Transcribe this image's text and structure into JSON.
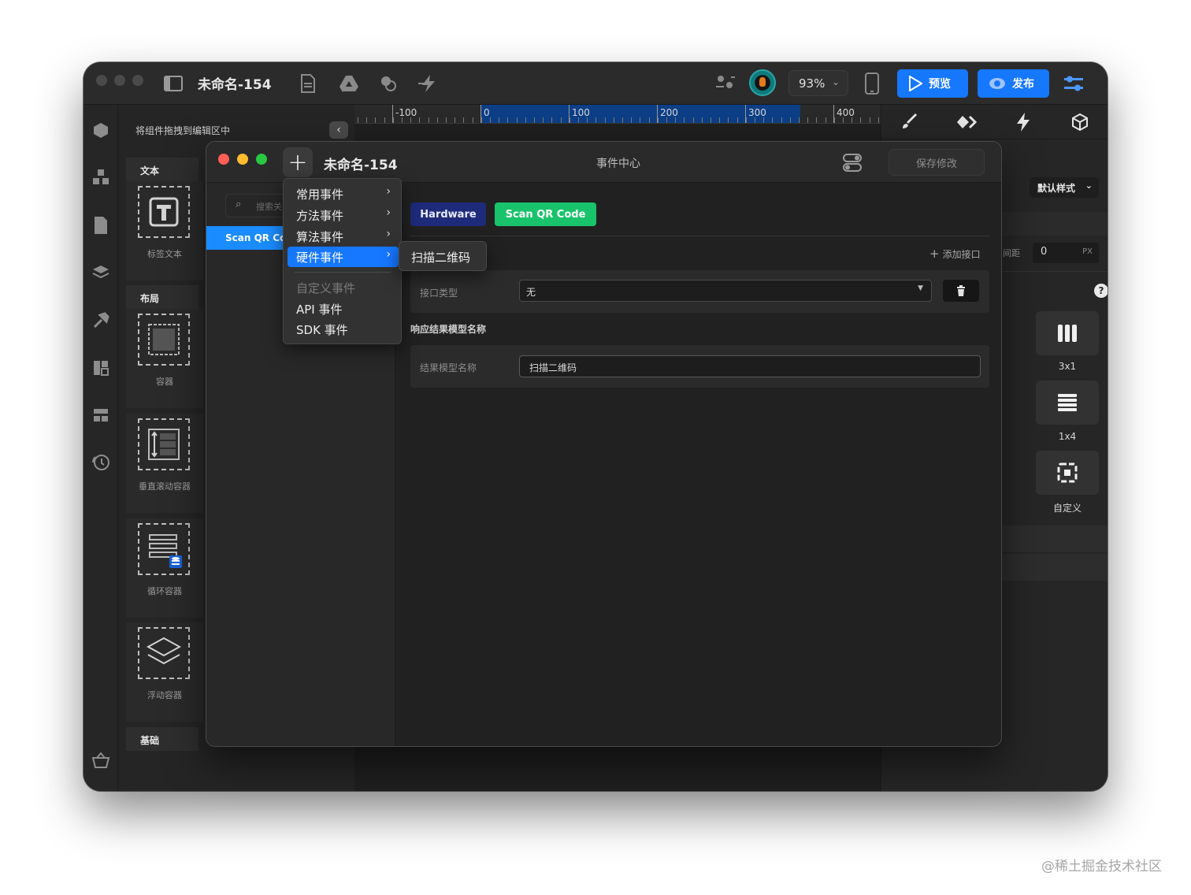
{
  "app": {
    "title": "未命名-154",
    "zoom": "93%",
    "preview_label": "预览",
    "publish_label": "发布"
  },
  "ruler": {
    "ticks": [
      "-100",
      "0",
      "100",
      "200",
      "300",
      "400"
    ]
  },
  "component_panel": {
    "header": "将组件拖拽到编辑区中",
    "sections": {
      "text": "文本",
      "layout": "布局",
      "basic": "基础"
    },
    "components": {
      "label_text": "标签文本",
      "container": "容器",
      "vertical_scroll": "垂直滚动容器",
      "loop_container": "循环容器",
      "float_container": "浮动容器"
    }
  },
  "right_panel": {
    "style_select": "默认样式",
    "spacing_label": "间距",
    "spacing_value": "0",
    "spacing_unit": "PX",
    "layouts": [
      "3x1",
      "1x4",
      "自定义"
    ]
  },
  "event_center": {
    "title": "事件中心",
    "doc_title": "未命名-154",
    "save_label": "保存修改",
    "search_placeholder": "搜索关",
    "selected_event": "Scan QR Code",
    "tags": {
      "hardware": "Hardware",
      "scan": "Scan QR Code"
    },
    "add_interface": "添加接口",
    "interface_type_label": "接口类型",
    "interface_type_value": "无",
    "response_section": "响应结果模型名称",
    "result_model_label": "结果模型名称",
    "result_model_value": "扫描二维码"
  },
  "menu": {
    "items": [
      "常用事件",
      "方法事件",
      "算法事件",
      "硬件事件"
    ],
    "disabled_item": "自定义事件",
    "items_bottom": [
      "API 事件",
      "SDK 事件"
    ],
    "active_index": 3,
    "submenu_item": "扫描二维码"
  },
  "watermark": "@稀土掘金技术社区",
  "colors": {
    "accent": "#1677ff",
    "hardware_tag": "#1e2a7a",
    "scan_tag": "#19c36b",
    "selected_row": "#1a8cff"
  }
}
